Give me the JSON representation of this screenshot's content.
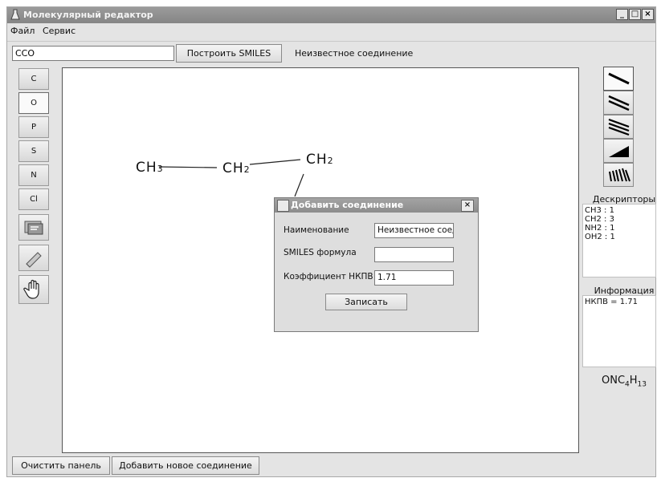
{
  "window": {
    "title": "Молекулярный редактор",
    "min": "_",
    "max": "□",
    "close": "×"
  },
  "menu": [
    "Файл",
    "Сервис"
  ],
  "toolbar": {
    "smiles_value": "CCO",
    "build_label": "Построить SMILES",
    "compound_name": "Неизвестное соединение"
  },
  "atoms": [
    "C",
    "O",
    "P",
    "S",
    "N",
    "Cl"
  ],
  "tools": [
    "template-icon",
    "eraser-icon",
    "hand-icon"
  ],
  "molecule": [
    {
      "main": "CH",
      "sub": "3"
    },
    {
      "main": "CH",
      "sub": "2"
    },
    {
      "main": "CH",
      "sub": "2"
    }
  ],
  "bond_tools": [
    "single-bond-icon",
    "double-bond-icon",
    "triple-bond-icon",
    "wedge-bond-icon",
    "hash-bond-icon"
  ],
  "descriptors": {
    "title": "Дескрипторы",
    "items": [
      "CH3 : 1",
      "CH2 : 3",
      "NH2 : 1",
      "OH2 : 1"
    ]
  },
  "info": {
    "title": "Информация",
    "text": "НКПВ = 1.71"
  },
  "formula": {
    "p1": "ONC",
    "s1": "4",
    "p2": "H",
    "s2": "13"
  },
  "bottom": {
    "clear_label": "Очистить панель",
    "add_label": "Добавить новое соединение"
  },
  "dialog": {
    "title": "Добавить соединение",
    "close": "×",
    "name_label": "Наименование",
    "name_value": "Неизвестное соеди",
    "smiles_label": "SMILES формула",
    "smiles_value": "",
    "coef_label": "Коэффициент НКПВ",
    "coef_value": "1.71",
    "save_label": "Записать"
  }
}
